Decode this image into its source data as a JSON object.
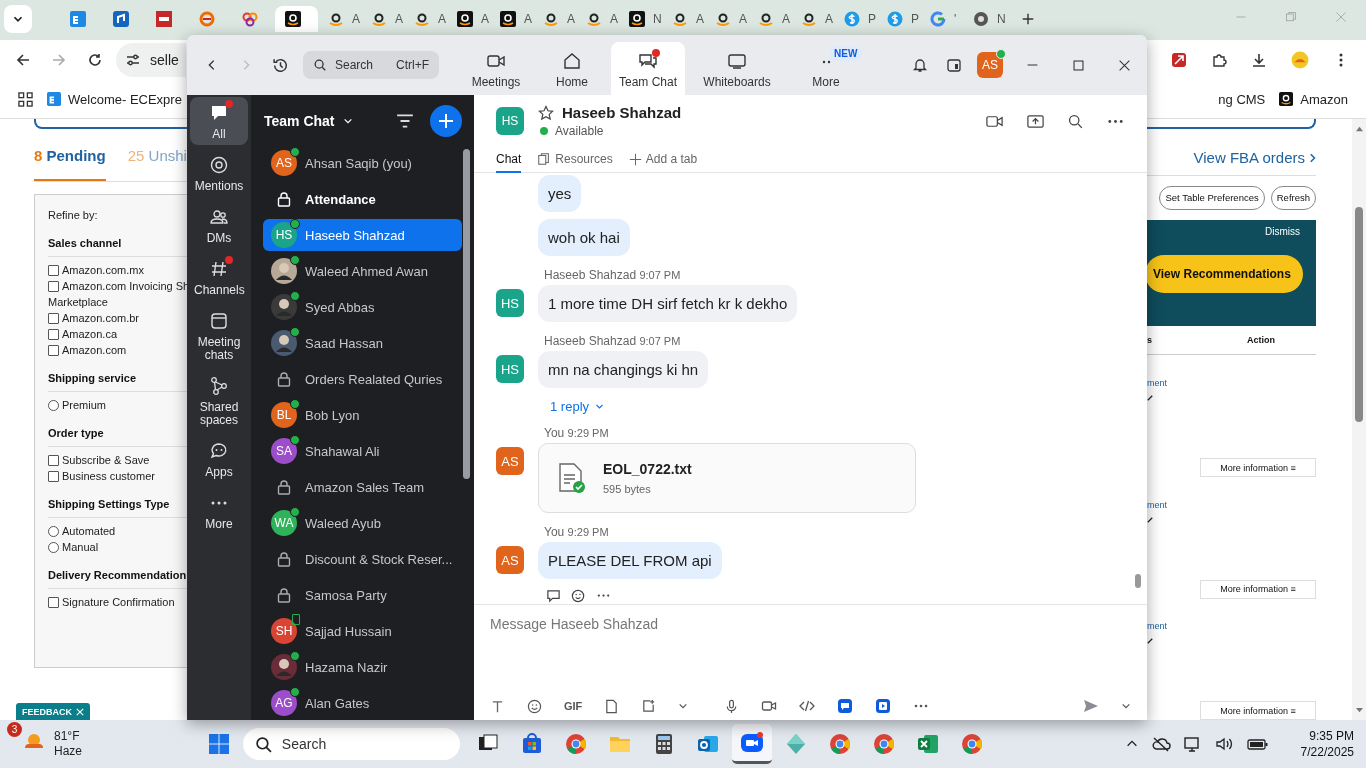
{
  "browser": {
    "tabs": [
      {
        "kind": "ec",
        "selected": false
      },
      {
        "kind": "blue",
        "selected": false
      },
      {
        "kind": "dh",
        "selected": false
      },
      {
        "kind": "swirl",
        "selected": false
      },
      {
        "kind": "circles",
        "selected": false
      },
      {
        "kind": "amazon-dark",
        "selected": true
      },
      {
        "kind": "amazon",
        "title": "A",
        "selected": false
      },
      {
        "kind": "amazon",
        "title": "A",
        "selected": false
      },
      {
        "kind": "amazon",
        "title": "A",
        "selected": false
      },
      {
        "kind": "amazon-dark",
        "title": "A",
        "selected": false
      },
      {
        "kind": "amazon-dark",
        "title": "A",
        "selected": false
      },
      {
        "kind": "amazon",
        "title": "A",
        "selected": false
      },
      {
        "kind": "amazon",
        "title": "A",
        "selected": false
      },
      {
        "kind": "amazon-dark",
        "title": "N",
        "selected": false
      },
      {
        "kind": "amazon",
        "title": "A",
        "selected": false
      },
      {
        "kind": "amazon",
        "title": "A",
        "selected": false
      },
      {
        "kind": "amazon",
        "title": "A",
        "selected": false
      },
      {
        "kind": "amazon",
        "title": "A",
        "selected": false
      },
      {
        "kind": "dollar",
        "title": "P",
        "selected": false
      },
      {
        "kind": "dollar",
        "title": "P",
        "selected": false
      },
      {
        "kind": "google",
        "title": "'",
        "selected": false
      },
      {
        "kind": "chrome",
        "title": "N",
        "selected": false
      }
    ],
    "url": "selle",
    "bookmarks_left": [
      {
        "kind": "ec",
        "label": "Welcome- ECExpre"
      }
    ],
    "bookmarks_right": [
      {
        "kind": "plain",
        "label": "ng CMS"
      },
      {
        "kind": "amazon-dark",
        "label": "Amazon"
      }
    ]
  },
  "page": {
    "tabs": [
      {
        "count": "8",
        "label": "Pending",
        "selected": true
      },
      {
        "count": "25",
        "label": "Unshi",
        "selected": false
      }
    ],
    "refine_title": "Refine by:",
    "filter_groups": [
      {
        "title": "Sales channel",
        "options": [
          {
            "kind": "checkbox",
            "label": "Amazon.com.mx",
            "checked": false
          },
          {
            "kind": "checkbox",
            "label": "Amazon.com Invoicing Sh",
            "continued": "Marketplace",
            "checked": false
          },
          {
            "kind": "checkbox",
            "label": "Amazon.com.br",
            "checked": false
          },
          {
            "kind": "checkbox",
            "label": "Amazon.ca",
            "checked": false
          },
          {
            "kind": "checkbox",
            "label": "Amazon.com",
            "checked": false
          }
        ]
      },
      {
        "title": "Shipping service",
        "options": [
          {
            "kind": "radio",
            "label": "Premium",
            "checked": false
          }
        ]
      },
      {
        "title": "Order type",
        "options": [
          {
            "kind": "checkbox",
            "label": "Subscribe & Save",
            "checked": false
          },
          {
            "kind": "checkbox",
            "label": "Business customer",
            "checked": false
          }
        ]
      },
      {
        "title": "Shipping Settings Type",
        "options": [
          {
            "kind": "radio",
            "label": "Automated",
            "checked": false
          },
          {
            "kind": "radio",
            "label": "Manual",
            "checked": false
          }
        ]
      },
      {
        "title": "Delivery Recommendation",
        "options": [
          {
            "kind": "checkbox",
            "label": "Signature Confirmation",
            "checked": false
          }
        ]
      }
    ],
    "view_fba": "View FBA orders",
    "buttons": [
      "Set Table Preferences",
      "Refresh"
    ],
    "banner": {
      "dismiss": "Dismiss",
      "button": "View Recommendations"
    },
    "table": {
      "columns": [
        "s",
        "Action"
      ],
      "rows": [
        {
          "column_1": "ment",
          "action": "More information ≡"
        },
        {
          "column_1": "ment",
          "action": "More information ≡"
        },
        {
          "column_1": "ment",
          "action": "More information ≡"
        }
      ]
    },
    "feedback": "FEEDBACK"
  },
  "zoom": {
    "search": {
      "placeholder": "Search",
      "shortcut": "Ctrl+F"
    },
    "nav": [
      {
        "kind": "video",
        "label": "Meetings",
        "selected": false,
        "dot": false
      },
      {
        "kind": "home",
        "label": "Home",
        "selected": false,
        "dot": false
      },
      {
        "kind": "chat",
        "label": "Team Chat",
        "selected": true,
        "dot": true
      },
      {
        "kind": "whiteboard",
        "label": "Whiteboards",
        "selected": false,
        "dot": false
      },
      {
        "kind": "dots",
        "label": "More",
        "badge": "NEW",
        "selected": false,
        "dot": false
      }
    ],
    "user": {
      "initials": "AS",
      "color": "#e0641b",
      "online": true
    },
    "rail": [
      {
        "kind": "chat",
        "label": "All",
        "selected": true,
        "dot": true
      },
      {
        "kind": "at",
        "label": "Mentions",
        "selected": false,
        "dot": false
      },
      {
        "kind": "people",
        "label": "DMs",
        "selected": false,
        "dot": false
      },
      {
        "kind": "hash",
        "label": "Channels",
        "selected": false,
        "dot": true
      },
      {
        "kind": "calendar",
        "label": "Meeting chats",
        "selected": false,
        "dot": false
      },
      {
        "kind": "share",
        "label": "Shared spaces",
        "selected": false,
        "dot": false
      },
      {
        "kind": "apps",
        "label": "Apps",
        "selected": false,
        "dot": false
      },
      {
        "kind": "dots",
        "label": "More",
        "selected": false,
        "dot": false
      }
    ],
    "chat_list": {
      "title": "Team Chat",
      "items": [
        {
          "kind": "person",
          "name": "Ahsan Saqib (you)",
          "initials": "AS",
          "color": "#e0641b",
          "online": true,
          "mobile": false,
          "selected": false,
          "unread": false
        },
        {
          "kind": "channel",
          "name": "Attendance",
          "selected": false,
          "unread": true
        },
        {
          "kind": "person",
          "name": "Haseeb Shahzad",
          "initials": "HS",
          "color": "#1aa58a",
          "online": true,
          "mobile": false,
          "selected": true,
          "unread": false
        },
        {
          "kind": "photo",
          "name": "Waleed Ahmed Awan",
          "color": "#b8a898",
          "online": true,
          "mobile": false,
          "selected": false,
          "unread": false
        },
        {
          "kind": "photo",
          "name": "Syed Abbas",
          "color": "#3a3a3a",
          "online": true,
          "mobile": false,
          "selected": false,
          "unread": false
        },
        {
          "kind": "photo",
          "name": "Saad Hassan",
          "color": "#4a5a70",
          "online": true,
          "mobile": false,
          "selected": false,
          "unread": false
        },
        {
          "kind": "channel",
          "name": "Orders Realated Quries",
          "selected": false,
          "unread": false
        },
        {
          "kind": "person",
          "name": "Bob Lyon",
          "initials": "BL",
          "color": "#e0641b",
          "online": true,
          "mobile": false,
          "selected": false,
          "unread": false
        },
        {
          "kind": "person",
          "name": "Shahawal Ali",
          "initials": "SA",
          "color": "#9b4dca",
          "online": true,
          "mobile": false,
          "selected": false,
          "unread": false
        },
        {
          "kind": "channel",
          "name": "Amazon Sales Team",
          "selected": false,
          "unread": false
        },
        {
          "kind": "person",
          "name": "Waleed Ayub",
          "initials": "WA",
          "color": "#2fb35a",
          "online": true,
          "mobile": false,
          "selected": false,
          "unread": false
        },
        {
          "kind": "channel",
          "name": "Discount & Stock Reser...",
          "selected": false,
          "unread": false
        },
        {
          "kind": "channel",
          "name": "Samosa Party",
          "selected": false,
          "unread": false
        },
        {
          "kind": "person",
          "name": "Sajjad Hussain",
          "initials": "SH",
          "color": "#d94535",
          "online": false,
          "mobile": true,
          "selected": false,
          "unread": false
        },
        {
          "kind": "photo",
          "name": "Hazama Nazir",
          "color": "#6b2c3a",
          "online": true,
          "mobile": false,
          "selected": false,
          "unread": false
        },
        {
          "kind": "person",
          "name": "Alan Gates",
          "initials": "AG",
          "color": "#9b4dca",
          "online": true,
          "mobile": false,
          "selected": false,
          "unread": false
        }
      ]
    },
    "conversation": {
      "name": "Haseeb Shahzad",
      "initials": "HS",
      "color": "#1aa58a",
      "status": "Available",
      "tabs": [
        {
          "kind": "plain",
          "label": "Chat",
          "selected": true
        },
        {
          "kind": "files",
          "label": "Resources",
          "selected": false
        },
        {
          "kind": "plus",
          "label": "Add a tab",
          "selected": false
        }
      ],
      "messages": [
        {
          "kind": "text",
          "own": true,
          "bubbles": [
            "yes",
            "woh ok hai"
          ]
        },
        {
          "kind": "text",
          "own": false,
          "sender": "Haseeb Shahzad",
          "time": "9:07 PM",
          "initials": "HS",
          "color": "#1aa58a",
          "bubbles": [
            "1 more time DH sirf fetch kr k dekho"
          ]
        },
        {
          "kind": "text",
          "own": false,
          "sender": "Haseeb Shahzad",
          "time": "9:07 PM",
          "initials": "HS",
          "color": "#1aa58a",
          "bubbles": [
            "mn na changings ki hn"
          ],
          "replies": "1 reply"
        },
        {
          "kind": "file",
          "sender": "You",
          "time": "9:29 PM",
          "initials": "AS",
          "color": "#e0641b",
          "file": {
            "name": "EOL_0722.txt",
            "size": "595 bytes"
          }
        },
        {
          "kind": "text",
          "own": true,
          "sender": "You",
          "time": "9:29 PM",
          "initials": "AS",
          "color": "#e0641b",
          "bubbles": [
            "PLEASE DEL FROM api"
          ],
          "actions": true
        }
      ],
      "composer": {
        "placeholder": "Message Haseeb Shahzad",
        "gif": "GIF"
      }
    }
  },
  "taskbar": {
    "weather": {
      "badge": "3",
      "temp": "81°F",
      "text": "Haze"
    },
    "search": "Search",
    "apps": [
      {
        "kind": "taskview",
        "selected": false
      },
      {
        "kind": "store",
        "selected": false
      },
      {
        "kind": "chrome",
        "selected": false
      },
      {
        "kind": "folder",
        "selected": false
      },
      {
        "kind": "calculator",
        "selected": false
      },
      {
        "kind": "outlook",
        "selected": false
      },
      {
        "kind": "zoom",
        "selected": true
      },
      {
        "kind": "diamond",
        "selected": false
      },
      {
        "kind": "chrome",
        "selected": false
      },
      {
        "kind": "chrome",
        "selected": false
      },
      {
        "kind": "excel",
        "selected": false
      },
      {
        "kind": "chrome",
        "selected": false
      }
    ],
    "clock": {
      "time": "9:35 PM",
      "date": "7/22/2025"
    }
  }
}
